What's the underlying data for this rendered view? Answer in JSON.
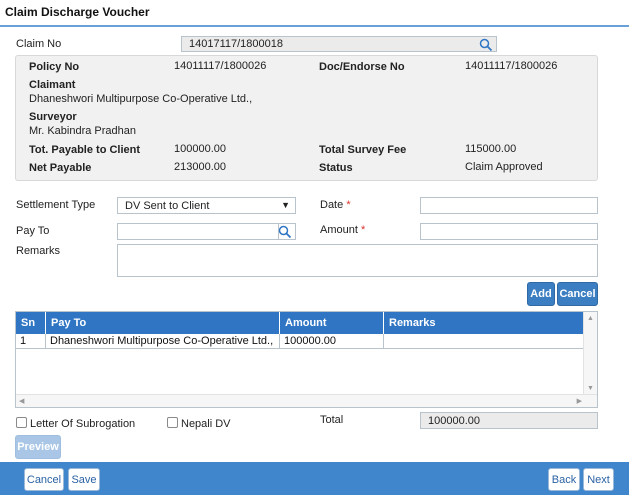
{
  "page": {
    "title": "Claim Discharge Voucher"
  },
  "claim": {
    "label": "Claim No",
    "value": "14017117/1800018"
  },
  "info": {
    "policy_no_label": "Policy No",
    "policy_no_value": "14011117/1800026",
    "doc_endorse_label": "Doc/Endorse No",
    "doc_endorse_value": "14011117/1800026",
    "claimant_label": "Claimant",
    "claimant_value": "Dhaneshwori Multipurpose Co-Operative Ltd.,",
    "surveyor_label": "Surveyor",
    "surveyor_value": "Mr. Kabindra Pradhan",
    "tot_payable_label": "Tot. Payable to Client",
    "tot_payable_value": "100000.00",
    "total_survey_fee_label": "Total Survey Fee",
    "total_survey_fee_value": "115000.00",
    "net_payable_label": "Net Payable",
    "net_payable_value": "213000.00",
    "status_label": "Status",
    "status_value": "Claim Approved"
  },
  "form": {
    "settlement_type_label": "Settlement Type",
    "settlement_type_value": "DV Sent to Client",
    "date_label": "Date",
    "date_value": "",
    "pay_to_label": "Pay To",
    "pay_to_value": "",
    "amount_label": "Amount",
    "amount_value": "",
    "remarks_label": "Remarks",
    "remarks_value": "",
    "required_mark": "*"
  },
  "buttons": {
    "add": "Add",
    "cancel": "Cancel",
    "preview": "Preview",
    "footer_cancel": "Cancel",
    "save": "Save",
    "back": "Back",
    "next": "Next"
  },
  "grid": {
    "columns": [
      "Sn",
      "Pay To",
      "Amount",
      "Remarks"
    ],
    "rows": [
      {
        "sn": "1",
        "pay_to": "Dhaneshwori Multipurpose Co-Operative Ltd.,",
        "amount": "100000.00",
        "remarks": ""
      }
    ]
  },
  "options": {
    "letter_of_subrogation": "Letter Of Subrogation",
    "nepali_dv": "Nepali DV"
  },
  "totals": {
    "label": "Total",
    "value": "100000.00"
  },
  "colors": {
    "accent": "#3c7ec2",
    "header_blue": "#2f75c4",
    "footer_blue": "#3f86cd",
    "required": "#d9302c"
  },
  "icons": {
    "search": "magnifier-icon",
    "dropdown": "triangle-down-icon"
  }
}
